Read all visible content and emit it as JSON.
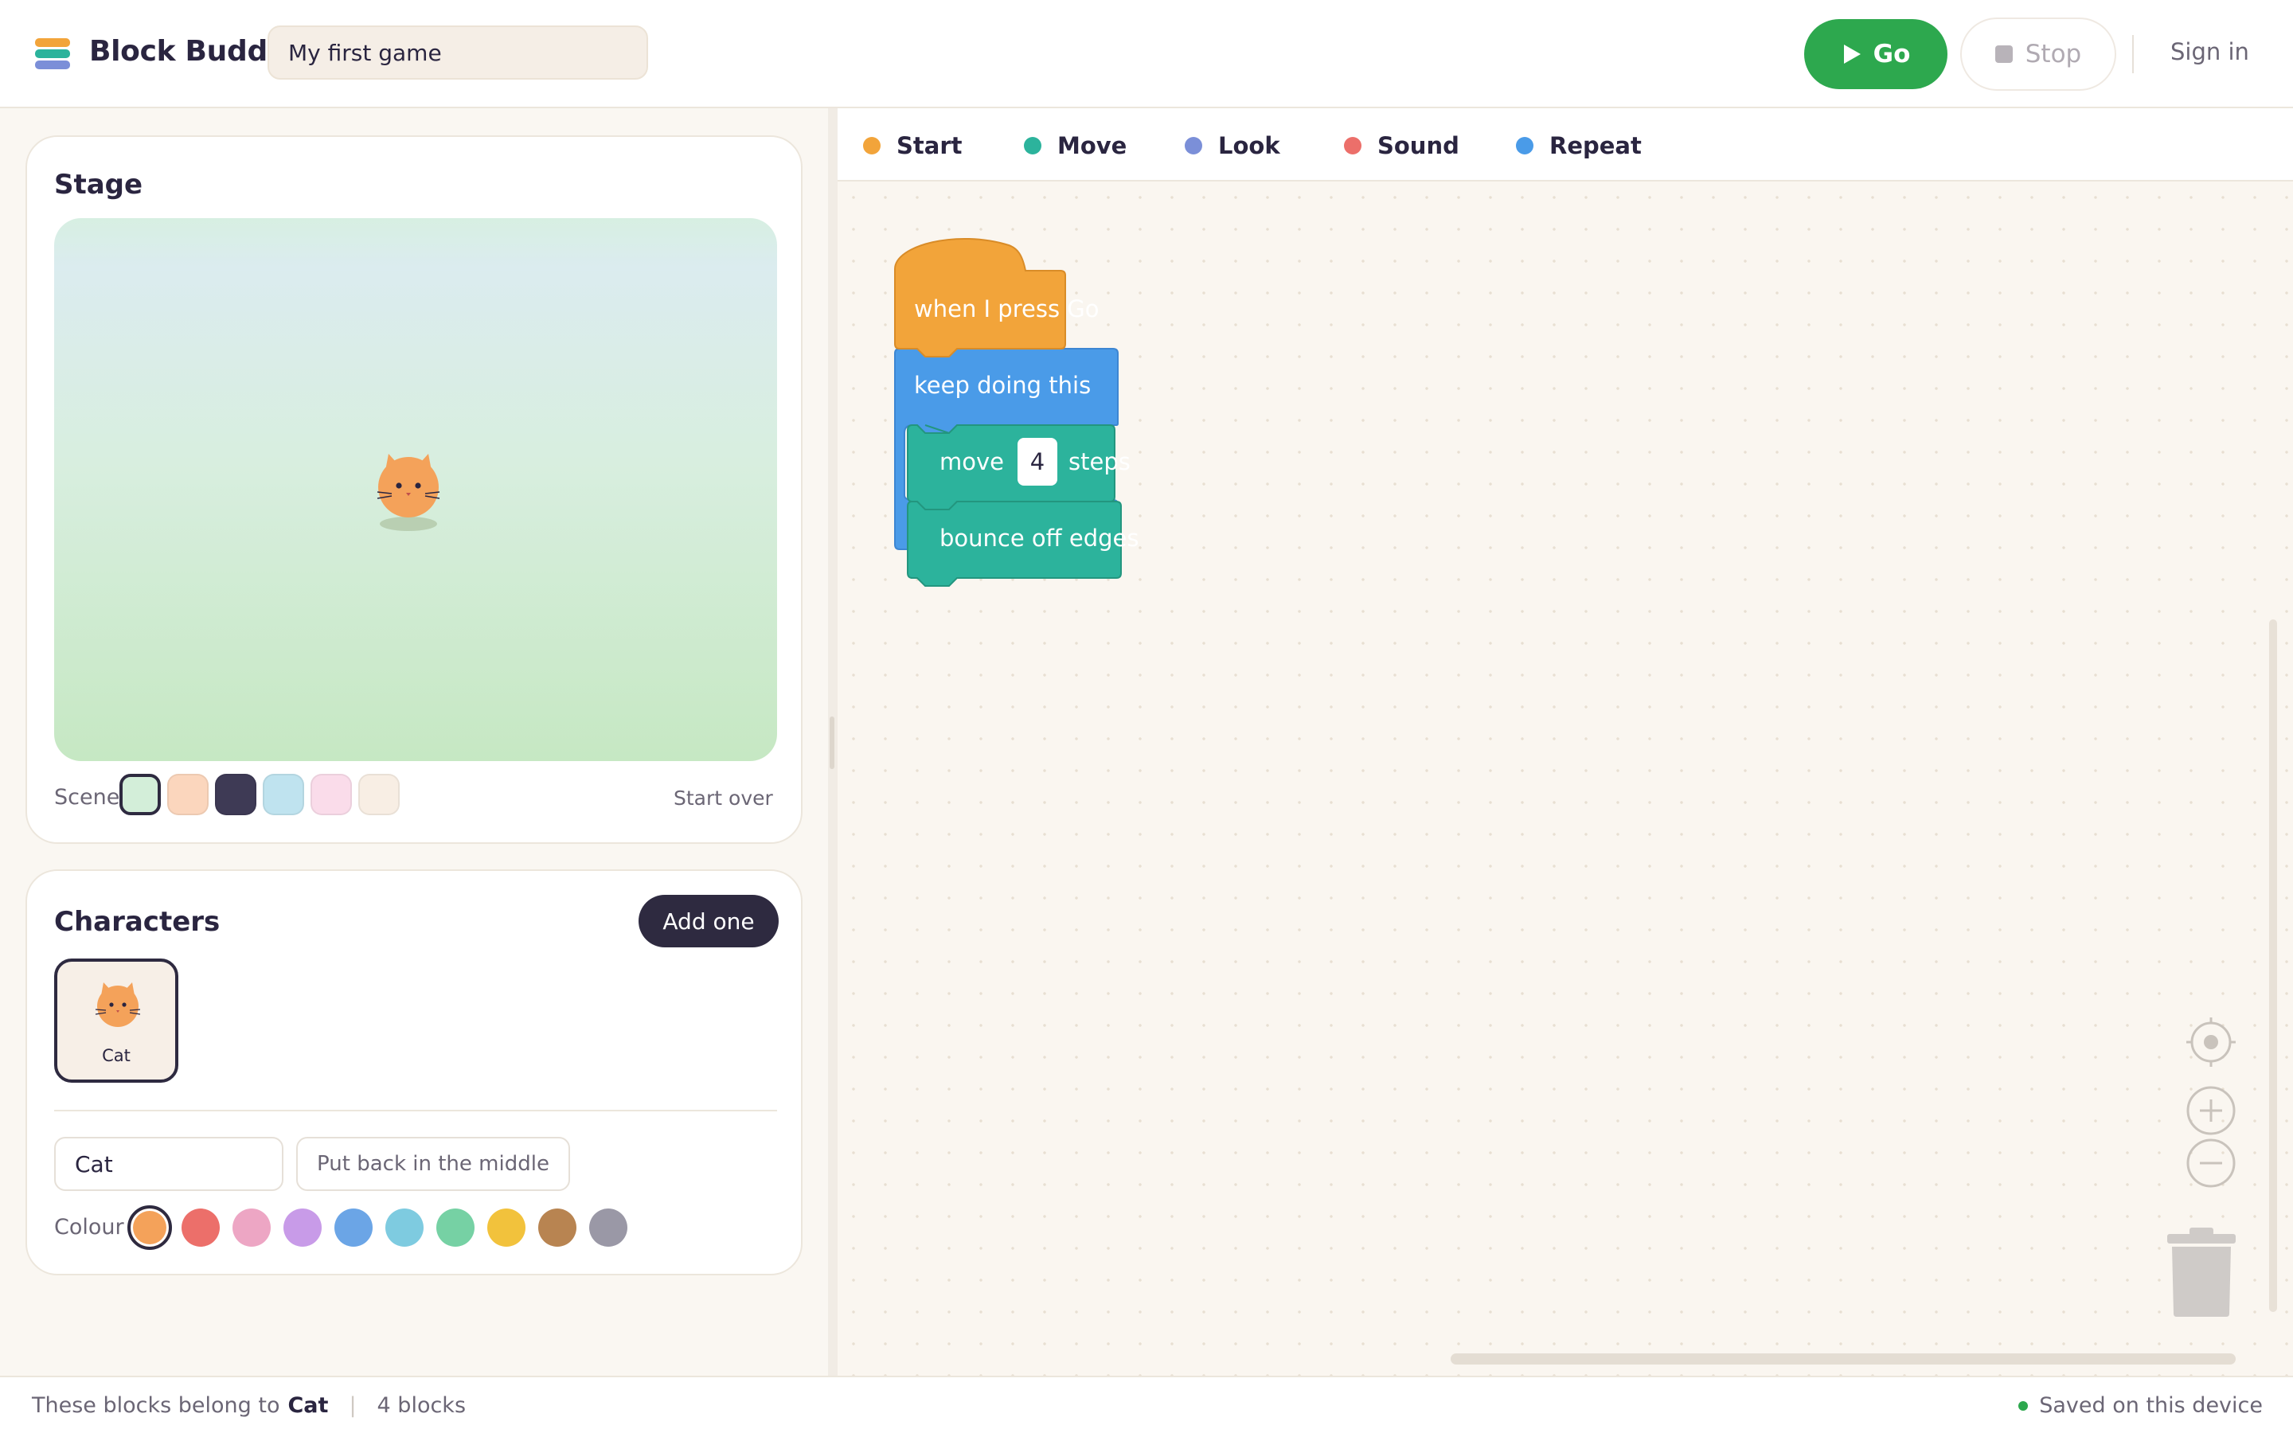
{
  "app": {
    "title": "Block Buddy",
    "project_name": "My first game"
  },
  "toolbar": {
    "go_label": "Go",
    "stop_label": "Stop",
    "sign_in_label": "Sign in"
  },
  "stage": {
    "title": "Stage",
    "scene_label": "Scene",
    "start_over_label": "Start over",
    "scene_colors": [
      "#d3eed9",
      "#fbd6bd",
      "#3e3a55",
      "#bfe3ef",
      "#fadcea",
      "#f8eee4"
    ],
    "selected_scene_index": 0
  },
  "characters": {
    "title": "Characters",
    "add_label": "Add one",
    "items": [
      {
        "name": "Cat",
        "icon": "cat-icon"
      }
    ],
    "selected_name_value": "Cat",
    "put_back_label": "Put back in the middle",
    "colour_label": "Colour",
    "colours": [
      "#f4a25a",
      "#ec6f6a",
      "#eda6c4",
      "#c89be8",
      "#6ba5e6",
      "#7ecbe0",
      "#76d1a4",
      "#f2c23c",
      "#b88451",
      "#9a98a6"
    ],
    "selected_colour_index": 0
  },
  "categories": [
    {
      "label": "Start",
      "color": "#f2a43a"
    },
    {
      "label": "Move",
      "color": "#2cb39c"
    },
    {
      "label": "Look",
      "color": "#7b8fd8"
    },
    {
      "label": "Sound",
      "color": "#ec6f6a"
    },
    {
      "label": "Repeat",
      "color": "#4a9be8"
    }
  ],
  "script_blocks": {
    "hat_label": "when I press Go",
    "repeat_label": "keep doing this",
    "move_prefix": "move",
    "move_steps_value": "4",
    "move_suffix": "steps",
    "bounce_label": "bounce off edges",
    "colors": {
      "start": "#f2a43a",
      "repeat": "#4a9be8",
      "move": "#2cb39c"
    }
  },
  "footer": {
    "belongs_prefix": "These blocks belong to",
    "owner": "Cat",
    "block_count": "4 blocks",
    "saved_status": "Saved on this device"
  }
}
